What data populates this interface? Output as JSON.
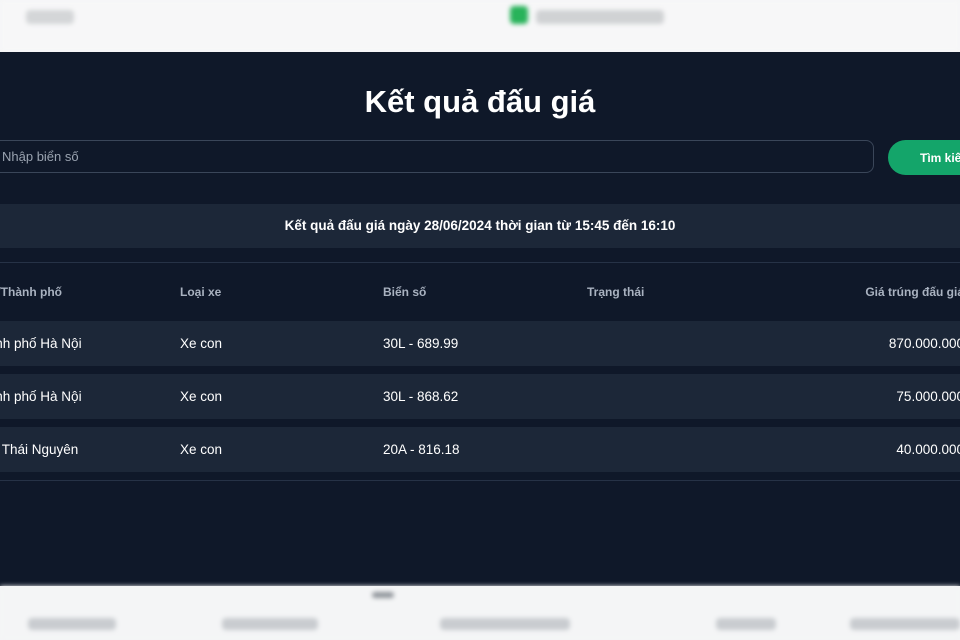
{
  "page": {
    "title": "Kết quả đấu giá"
  },
  "search": {
    "placeholder": "Nhập biển số",
    "button_label": "Tìm kiếm"
  },
  "session": {
    "text": "Kết quả đấu giá ngày 28/06/2024 thời gian từ 15:45 đến 16:10"
  },
  "table": {
    "columns": [
      "Tỉnh/Thành phố",
      "Loại xe",
      "Biển số",
      "Trạng thái",
      "Giá trúng đấu giá"
    ],
    "rows": [
      [
        "Thành phố Hà Nội",
        "Xe con",
        "30L - 689.99",
        "",
        "870.000.000"
      ],
      [
        "Thành phố Hà Nội",
        "Xe con",
        "30L - 868.62",
        "",
        "75.000.000"
      ],
      [
        "Tỉnh Thái Nguyên",
        "Xe con",
        "20A - 816.18",
        "",
        "40.000.000"
      ]
    ]
  },
  "colors": {
    "panel_bg": "#0f1829",
    "row_bg": "#1c2738",
    "accent_green": "#14a56a"
  }
}
